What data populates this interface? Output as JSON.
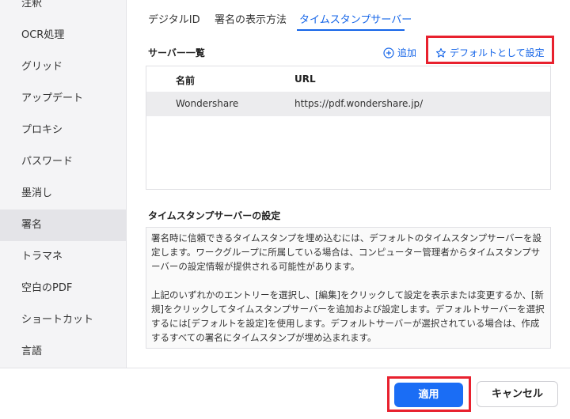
{
  "sidebar": {
    "items": [
      {
        "label": "注釈"
      },
      {
        "label": "OCR処理"
      },
      {
        "label": "グリッド"
      },
      {
        "label": "アップデート"
      },
      {
        "label": "プロキシ"
      },
      {
        "label": "パスワード"
      },
      {
        "label": "墨消し"
      },
      {
        "label": "署名",
        "active": true
      },
      {
        "label": "トラマネ"
      },
      {
        "label": "空白のPDF"
      },
      {
        "label": "ショートカット"
      },
      {
        "label": "言語"
      }
    ]
  },
  "tabs": [
    {
      "label": "デジタルID"
    },
    {
      "label": "署名の表示方法"
    },
    {
      "label": "タイムスタンプサーバー",
      "active": true
    }
  ],
  "server_list": {
    "title": "サーバー一覧",
    "add_label": "追加",
    "default_label": "デフォルトとして設定",
    "columns": [
      "名前",
      "URL"
    ],
    "rows": [
      {
        "name": "Wondershare",
        "url": "https://pdf.wondershare.jp/"
      }
    ]
  },
  "settings": {
    "title": "タイムスタンプサーバーの設定",
    "paragraph1": "署名時に信頼できるタイムスタンプを埋め込むには、デフォルトのタイムスタンプサーバーを設定します。ワークグループに所属している場合は、コンピューター管理者からタイムスタンプサーバーの設定情報が提供される可能性があります。",
    "paragraph2": "上記のいずれかのエントリーを選択し、[編集]をクリックして設定を表示または変更するか、[新規]をクリックしてタイムスタンプサーバーを追加および設定します。デフォルトサーバーを選択するには[デフォルトを設定]を使用します。デフォルトサーバーが選択されている場合は、作成するすべての署名にタイムスタンプが埋め込まれます。"
  },
  "footer": {
    "apply_label": "適用",
    "cancel_label": "キャンセル"
  },
  "colors": {
    "accent": "#1565e8",
    "highlight": "#e8212e"
  }
}
